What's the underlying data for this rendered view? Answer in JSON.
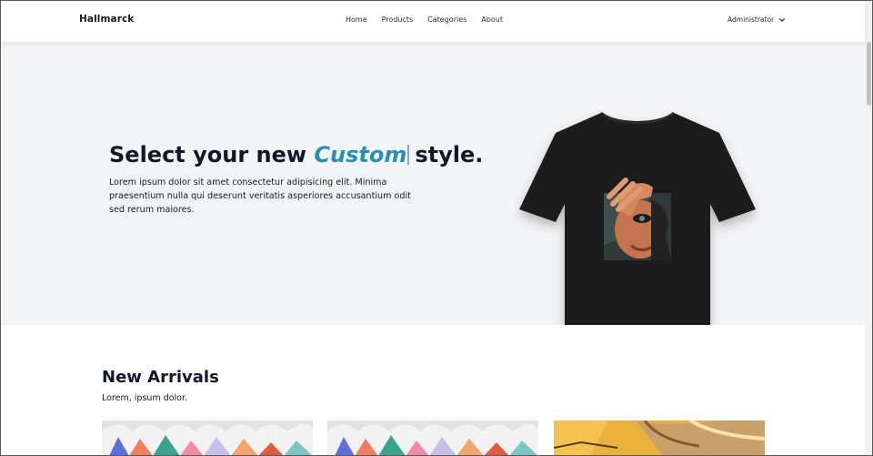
{
  "navbar": {
    "brand": "Hallmarck",
    "links": [
      "Home",
      "Products",
      "Categories",
      "About"
    ],
    "user": "Administrator"
  },
  "hero": {
    "title_prefix": "Select your new ",
    "title_accent": "Custom",
    "title_suffix": "style.",
    "description": "Lorem ipsum dolor sit amet consectetur adipisicing elit. Minima praesentium nulla qui deserunt veritatis asperiores accusantium odit sed rerum maiores."
  },
  "new_arrivals": {
    "title": "New Arrivals",
    "subtitle": "Lorem, ipsum dolor."
  },
  "colors": {
    "accent": "#2591b3",
    "hero_bg": "#f3f4f6",
    "text": "#111827"
  },
  "icons": [
    "chevron-down-icon"
  ]
}
